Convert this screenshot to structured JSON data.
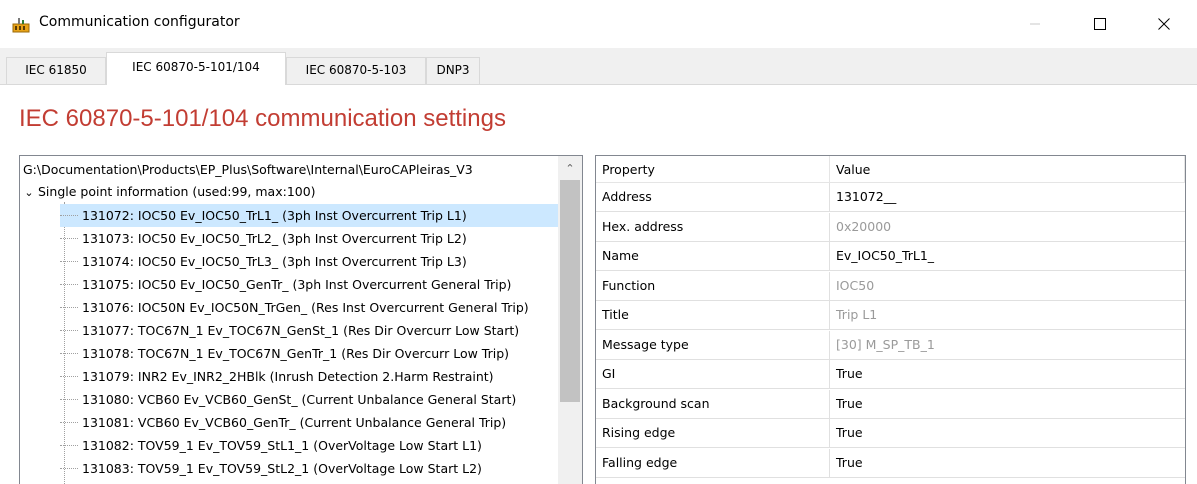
{
  "window": {
    "title": "Communication configurator"
  },
  "tabs": [
    {
      "label": "IEC 61850"
    },
    {
      "label": "IEC 60870-5-101/104"
    },
    {
      "label": "IEC 60870-5-103"
    },
    {
      "label": "DNP3"
    }
  ],
  "active_tab": "IEC 60870-5-101/104",
  "heading": "IEC 60870-5-101/104 communication settings",
  "colors": {
    "heading": "#c23d33",
    "selection": "#cce8ff"
  },
  "tree": {
    "path": "G:\\Documentation\\Products\\EP_Plus\\Software\\Internal\\EuroCAPleiras_V3",
    "group": "Single point information (used:99, max:100)",
    "items": [
      {
        "label": "131072: IOC50 Ev_IOC50_TrL1_ (3ph Inst Overcurrent Trip L1)",
        "selected": true
      },
      {
        "label": "131073: IOC50 Ev_IOC50_TrL2_ (3ph Inst Overcurrent Trip L2)"
      },
      {
        "label": "131074: IOC50 Ev_IOC50_TrL3_ (3ph Inst Overcurrent Trip L3)"
      },
      {
        "label": "131075: IOC50 Ev_IOC50_GenTr_ (3ph Inst Overcurrent General Trip)"
      },
      {
        "label": "131076: IOC50N Ev_IOC50N_TrGen_ (Res Inst Overcurrent General Trip)"
      },
      {
        "label": "131077: TOC67N_1 Ev_TOC67N_GenSt_1 (Res Dir Overcurr Low Start)"
      },
      {
        "label": "131078: TOC67N_1 Ev_TOC67N_GenTr_1 (Res Dir Overcurr Low Trip)"
      },
      {
        "label": "131079: INR2 Ev_INR2_2HBlk (Inrush Detection 2.Harm Restraint)"
      },
      {
        "label": "131080: VCB60 Ev_VCB60_GenSt_ (Current Unbalance General Start)"
      },
      {
        "label": "131081: VCB60 Ev_VCB60_GenTr_ (Current Unbalance General Trip)"
      },
      {
        "label": "131082: TOV59_1 Ev_TOV59_StL1_1 (OverVoltage Low Start L1)"
      },
      {
        "label": "131083: TOV59_1 Ev_TOV59_StL2_1 (OverVoltage Low Start L2)"
      }
    ]
  },
  "properties": {
    "header": {
      "property": "Property",
      "value": "Value"
    },
    "rows": [
      {
        "property": "Address",
        "value": "131072__",
        "readonly": false
      },
      {
        "property": "Hex. address",
        "value": "0x20000",
        "readonly": true
      },
      {
        "property": "Name",
        "value": "Ev_IOC50_TrL1_",
        "readonly": false
      },
      {
        "property": "Function",
        "value": "IOC50",
        "readonly": true
      },
      {
        "property": "Title",
        "value": "Trip L1",
        "readonly": true
      },
      {
        "property": "Message type",
        "value": "[30] M_SP_TB_1",
        "readonly": true
      },
      {
        "property": "GI",
        "value": "True",
        "readonly": false
      },
      {
        "property": "Background scan",
        "value": "True",
        "readonly": false
      },
      {
        "property": "Rising edge",
        "value": "True",
        "readonly": false
      },
      {
        "property": "Falling edge",
        "value": "True",
        "readonly": false
      }
    ]
  }
}
